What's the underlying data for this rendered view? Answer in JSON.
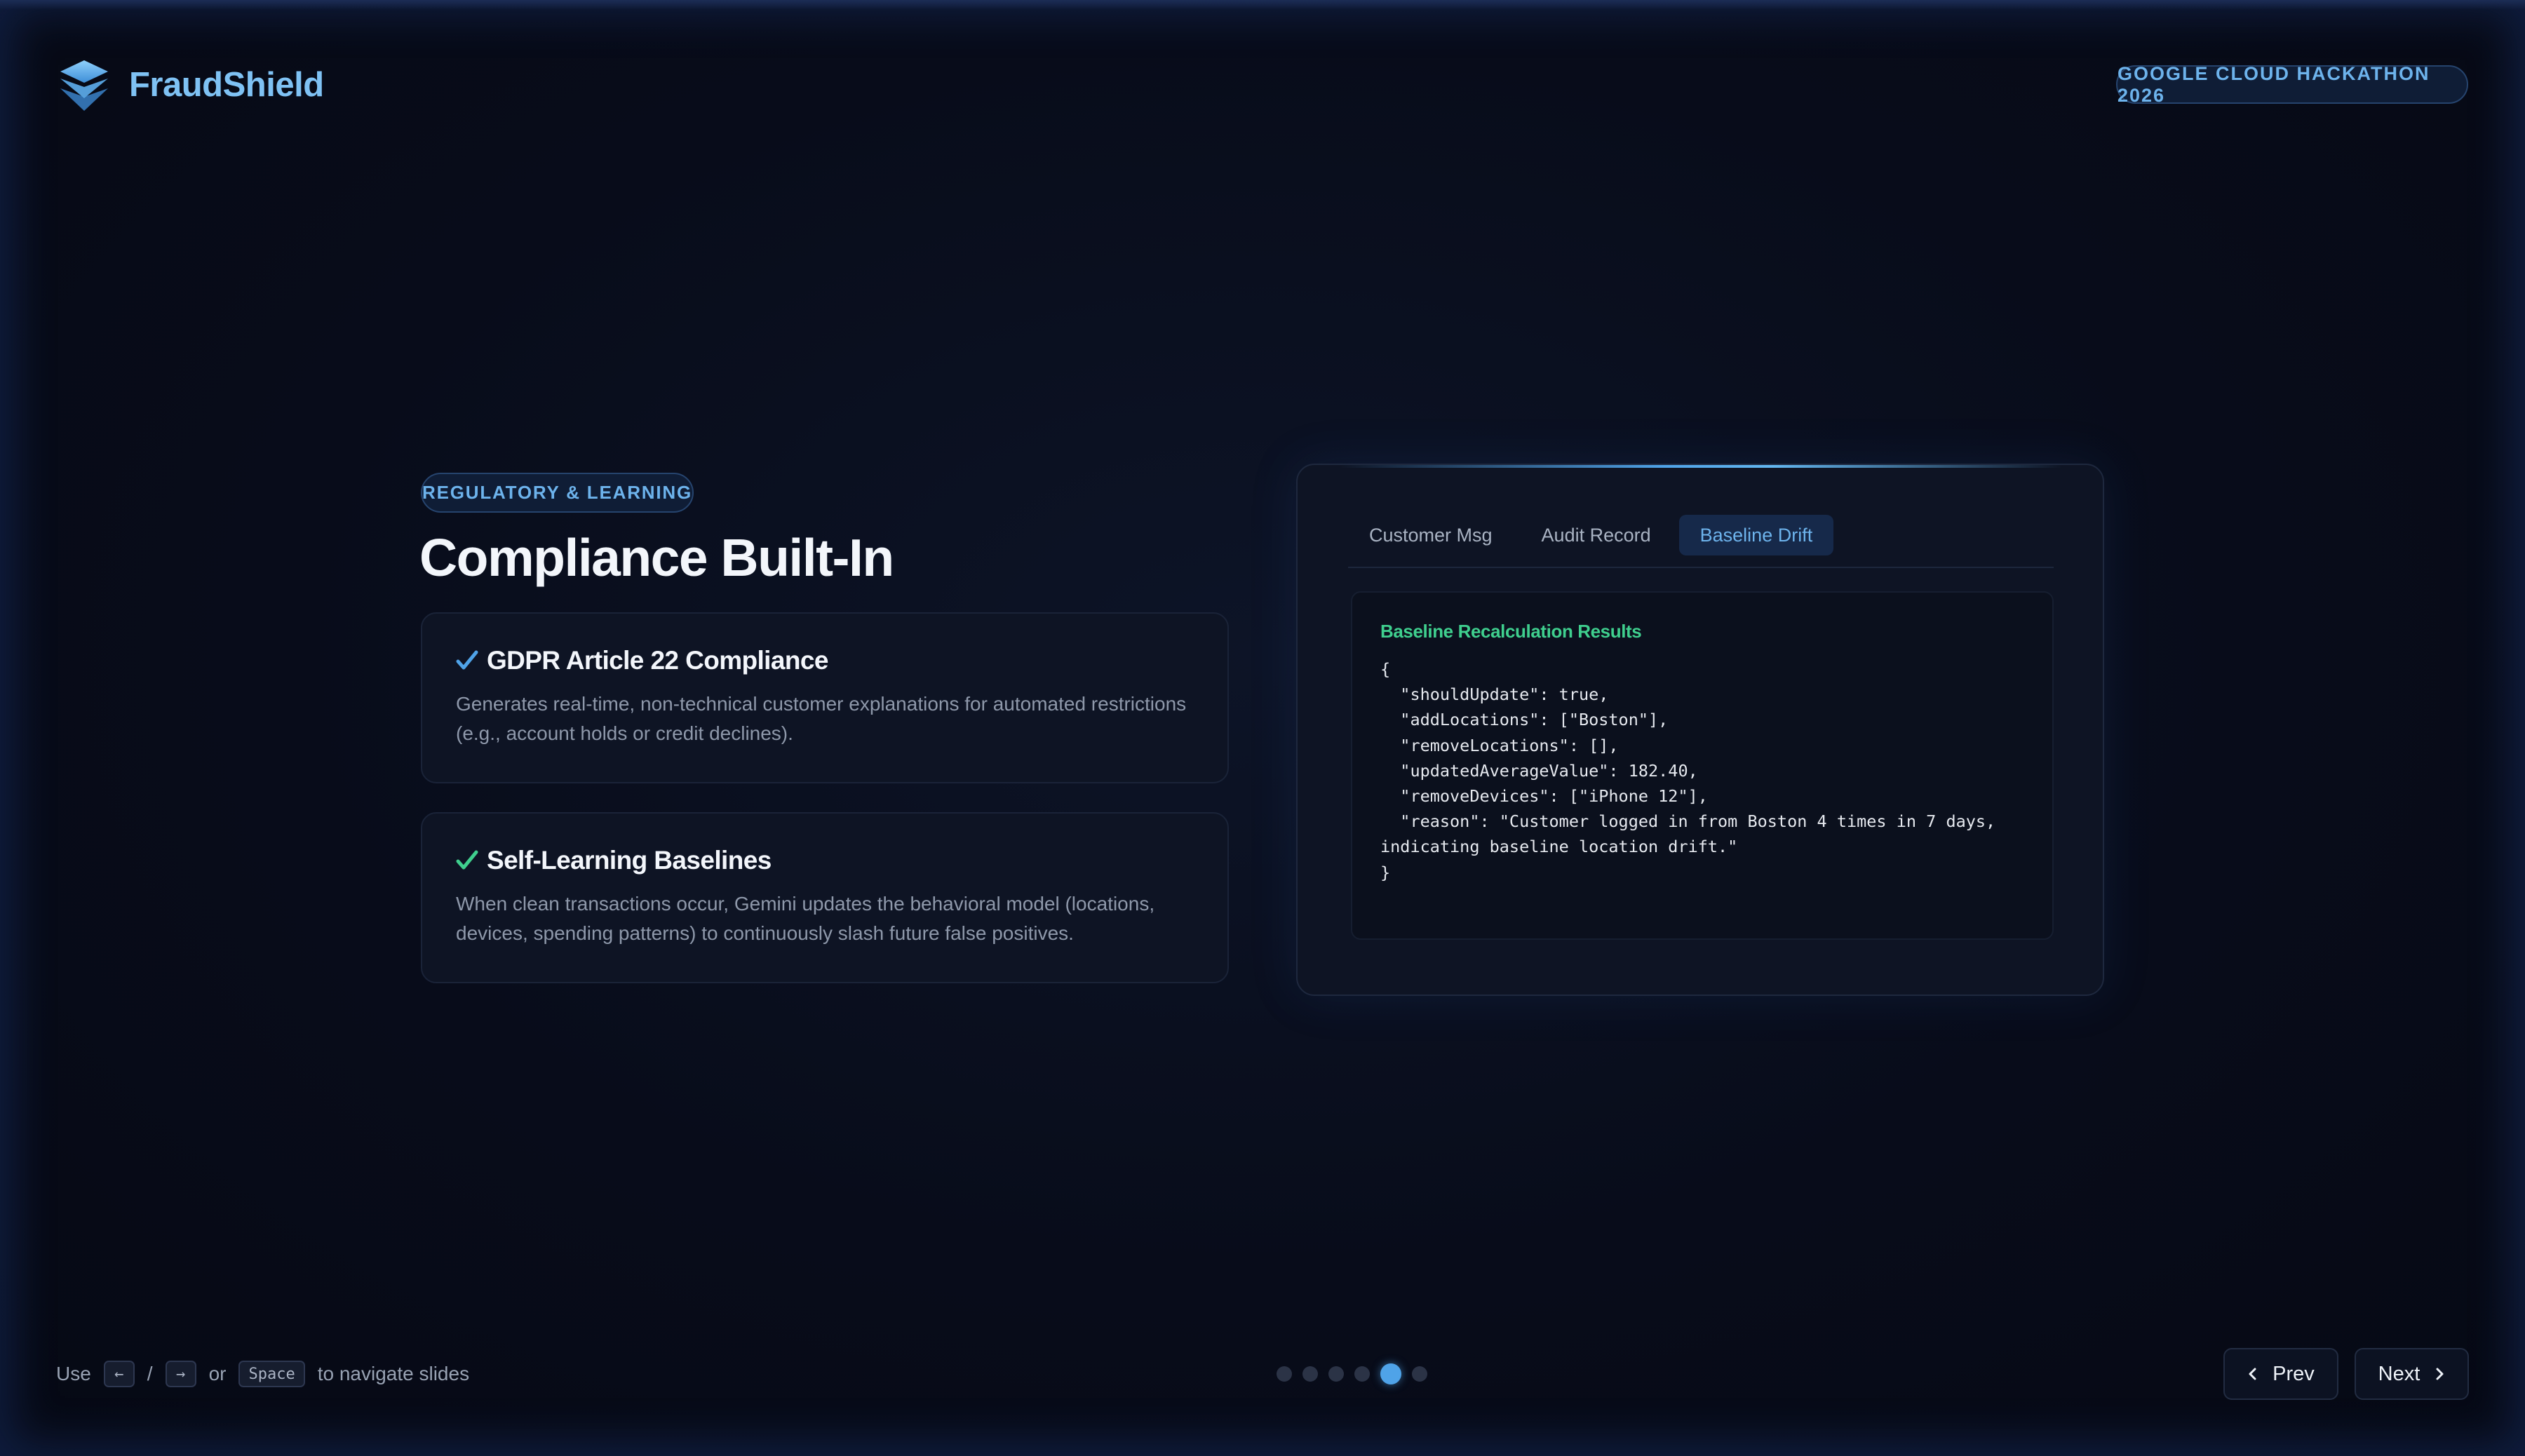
{
  "brand": {
    "name": "FraudShield",
    "logo_icon": "stacked-layers-icon",
    "accent": "#7fc2f4"
  },
  "event_badge": "GOOGLE CLOUD HACKATHON 2026",
  "slide": {
    "section_tag": "REGULATORY & LEARNING",
    "title": "Compliance Built-In",
    "features": [
      {
        "icon": "checkmark-icon",
        "icon_color": "#4fa3e8",
        "title": "GDPR Article 22 Compliance",
        "description": "Generates real-time, non-technical customer explanations for automated restrictions (e.g., account holds or credit declines)."
      },
      {
        "icon": "checkmark-icon",
        "icon_color": "#3fcf8e",
        "title": "Self-Learning Baselines",
        "description": "When clean transactions occur, Gemini updates the behavioral model (locations, devices, spending patterns) to continuously slash future false positives."
      }
    ]
  },
  "demo_panel": {
    "tabs": [
      {
        "label": "Customer Msg",
        "active": false
      },
      {
        "label": "Audit Record",
        "active": false
      },
      {
        "label": "Baseline Drift",
        "active": true
      }
    ],
    "result_title": "Baseline Recalculation Results",
    "result_title_color": "#3fcf8e",
    "json_output": "{\n  \"shouldUpdate\": true,\n  \"addLocations\": [\"Boston\"],\n  \"removeLocations\": [],\n  \"updatedAverageValue\": 182.40,\n  \"removeDevices\": [\"iPhone 12\"],\n  \"reason\": \"Customer logged in from Boston 4 times in 7 days,\nindicating baseline location drift.\"\n}"
  },
  "footer": {
    "hint_use": "Use",
    "key_left": "←",
    "slash": "/",
    "key_right": "→",
    "hint_or": "or",
    "key_space": "Space",
    "hint_rest": "to navigate slides",
    "slides_total": 6,
    "current_slide": 5,
    "prev_label": "Prev",
    "next_label": "Next"
  }
}
